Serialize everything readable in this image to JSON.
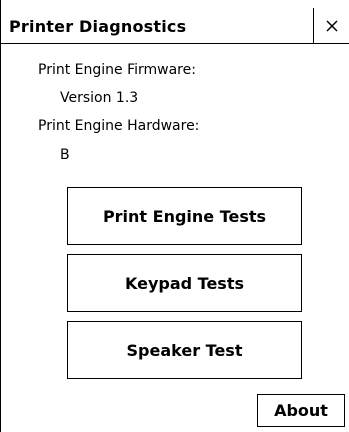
{
  "window": {
    "title": "Printer Diagnostics",
    "close_label": "×"
  },
  "info": {
    "firmware_label": "Print Engine Firmware:",
    "firmware_value": "Version 1.3",
    "hardware_label": "Print Engine Hardware:",
    "hardware_value": "B"
  },
  "buttons": {
    "print_engine_tests": "Print Engine Tests",
    "keypad_tests": "Keypad Tests",
    "speaker_test": "Speaker Test",
    "about": "About"
  }
}
